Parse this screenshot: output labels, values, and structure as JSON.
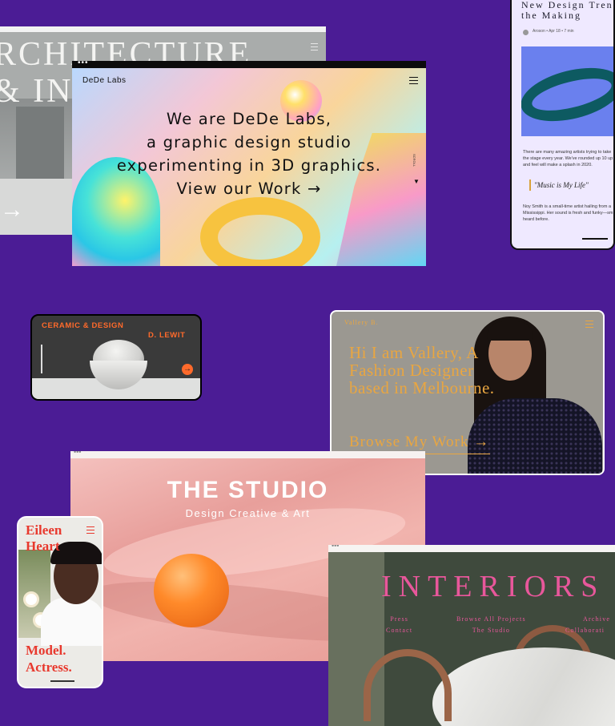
{
  "architecture": {
    "title_line1": "RCHITECTURE",
    "title_line2": "& INT",
    "arrow": "→"
  },
  "trends": {
    "title_line1": "New Design Tren",
    "title_line2": "the Making",
    "meta": "Aroson  •  Apr 18  •  7 min",
    "body": "There are many amazing artists trying to take the stage every year. We've rounded up 10 up and feel will make a splash in 2020.",
    "quote": "\"Music is My Life\"",
    "body2": "Noy Smith is a small-time artist hailing from a Mississippi. Her sound is fresh and funky—sm heard before."
  },
  "dede": {
    "logo": "DeDe Labs",
    "menu_dots": "•••",
    "hero_line1": "We are DeDe Labs,",
    "hero_line2": "a graphic design studio",
    "hero_line3": "experimenting in 3D graphics.",
    "hero_line4": "View our Work →",
    "side_text": "SCROLL"
  },
  "ceramic": {
    "title": "CERAMIC & DESIGN",
    "name": "D. LEWIT",
    "button_arrow": "→"
  },
  "vallery": {
    "name": "Vallery B.",
    "hero": "Hi I am Vallery, A Fashion Designer based in Melbourne.",
    "cta": "Browse My Work →"
  },
  "studio": {
    "menu_dots": "•••",
    "title": "THE STUDIO",
    "subtitle": "Design Creative & Art"
  },
  "eileen": {
    "name_line1": "Eileen",
    "name_line2": "Heart",
    "tag_line1": "Model.",
    "tag_line2": "Actress."
  },
  "interiors": {
    "menu_dots": "•••",
    "title": "INTERIORS",
    "nav_col1": [
      "Press",
      "Contact"
    ],
    "nav_col2": [
      "Browse All Projects",
      "The Studio"
    ],
    "nav_col3": [
      "Archive",
      "Collaborati"
    ]
  },
  "colors": {
    "background": "#4b1c95",
    "ceramic_accent": "#ff6a2b",
    "vallery_accent": "#e9a641",
    "eileen_accent": "#e8392e",
    "interiors_accent": "#e8579b"
  }
}
